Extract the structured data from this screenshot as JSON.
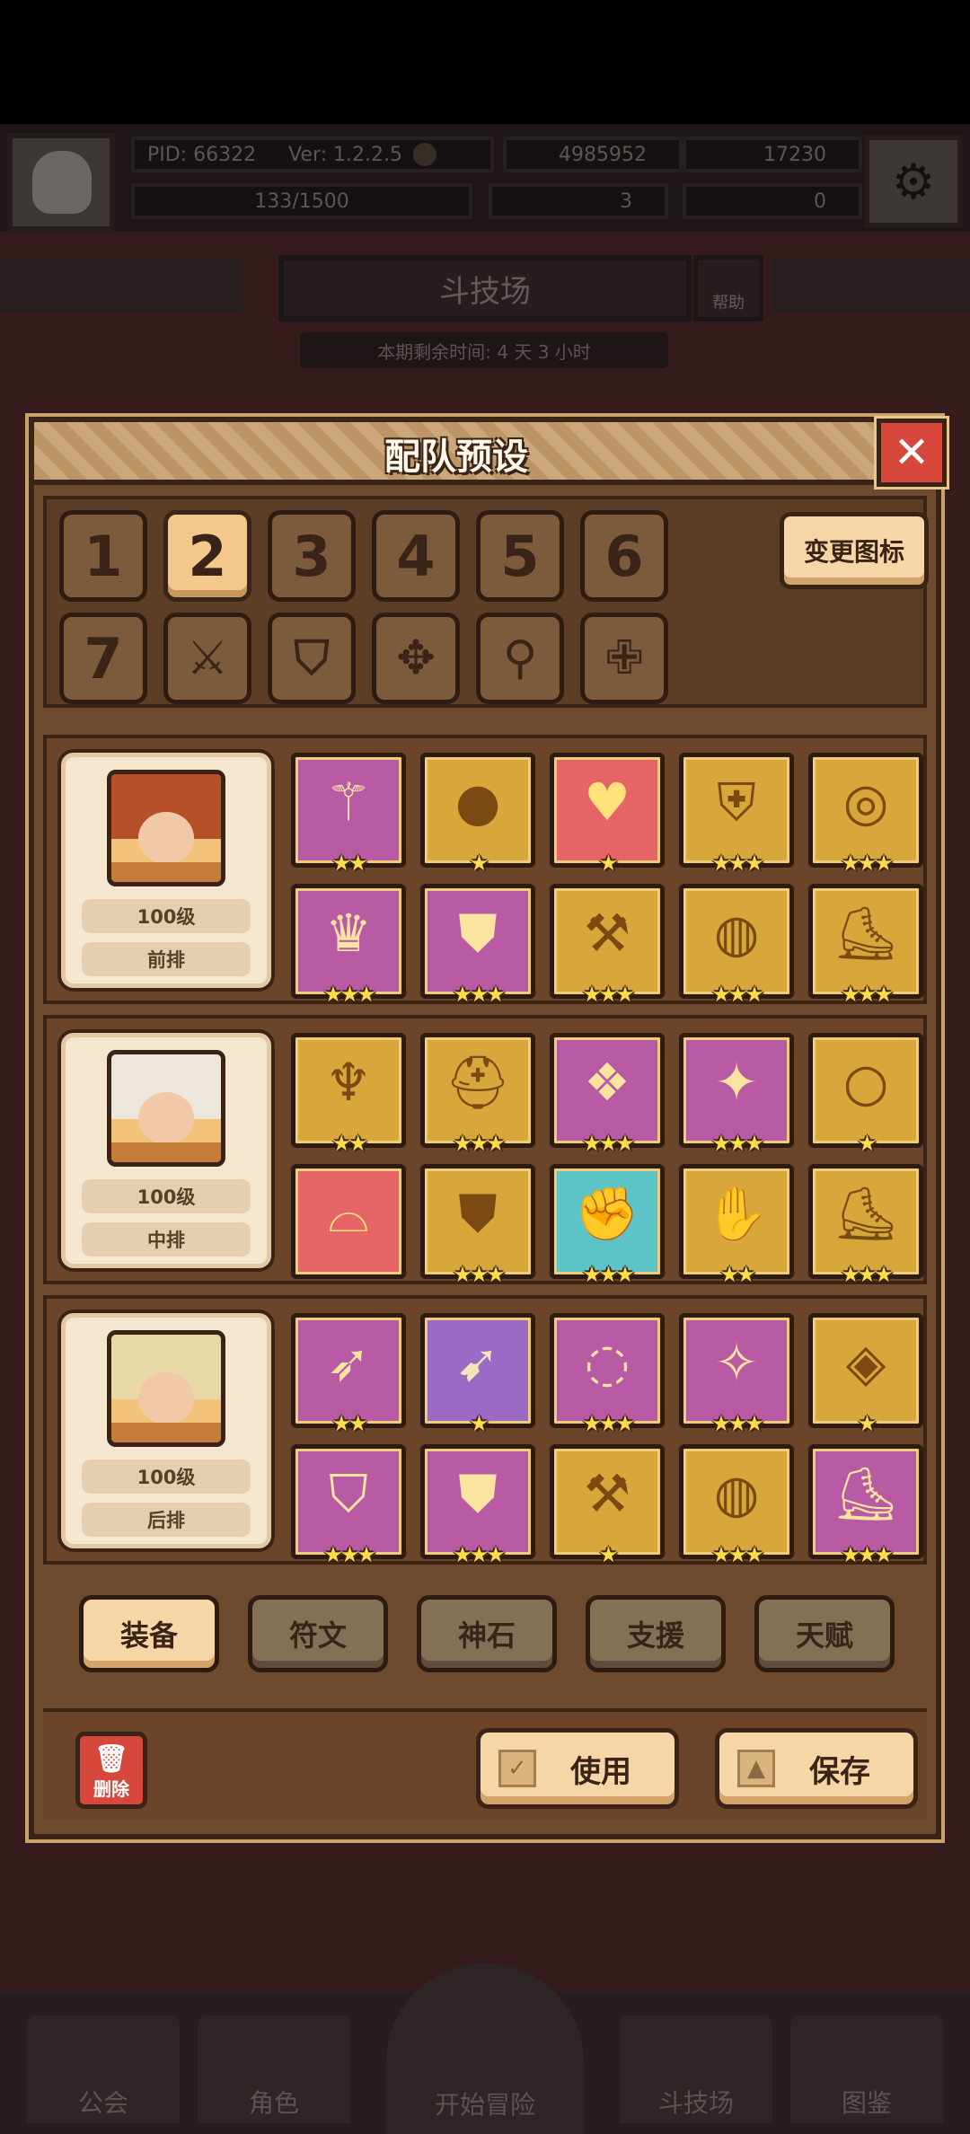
{
  "background": {
    "pid_label": "PID: 66322",
    "version_label": "Ver: 1.2.2.5",
    "gold_amount": "4985952",
    "gem_amount": "17230",
    "stamina": "133/1500",
    "clover_count": "3",
    "key_count": "0",
    "screen_title": "斗技场",
    "help_label": "帮助",
    "season_timer": "本期剩余时间: 4 天 3 小时",
    "nav": {
      "guild": "公会",
      "character": "角色",
      "start_adventure": "开始冒险",
      "arena": "斗技场",
      "codex": "图鉴"
    }
  },
  "dialog": {
    "title": "配队预设",
    "close_icon": "close-icon",
    "preset_slots": [
      {
        "label": "1",
        "selected": false
      },
      {
        "label": "2",
        "selected": true
      },
      {
        "label": "3",
        "selected": false
      },
      {
        "label": "4",
        "selected": false
      },
      {
        "label": "5",
        "selected": false
      },
      {
        "label": "6",
        "selected": false
      }
    ],
    "preset_icons": [
      "sword-icon",
      "shield-icon",
      "crosshair-icon",
      "staff-icon",
      "cross-icon"
    ],
    "preset_slot_7": "7",
    "change_icon_label": "变更图标",
    "heroes": [
      {
        "level": "100级",
        "position": "前排",
        "items": [
          {
            "icon": "scepter-icon",
            "rarity": "purple",
            "stars": 2
          },
          {
            "icon": "orb-icon",
            "rarity": "gold",
            "stars": 1
          },
          {
            "icon": "heart-necklace-icon",
            "rarity": "red",
            "stars": 1
          },
          {
            "icon": "gold-armor-icon",
            "rarity": "gold",
            "stars": 3
          },
          {
            "icon": "gold-ring-icon",
            "rarity": "gold",
            "stars": 3
          },
          {
            "icon": "crown-icon",
            "rarity": "purple",
            "stars": 3
          },
          {
            "icon": "robe-icon",
            "rarity": "purple",
            "stars": 3
          },
          {
            "icon": "hammer-icon",
            "rarity": "gold",
            "stars": 3
          },
          {
            "icon": "belt-icon",
            "rarity": "gold",
            "stars": 3
          },
          {
            "icon": "boots-icon",
            "rarity": "gold",
            "stars": 3
          }
        ]
      },
      {
        "level": "100级",
        "position": "中排",
        "items": [
          {
            "icon": "trident-icon",
            "rarity": "gold",
            "stars": 2
          },
          {
            "icon": "helm-icon",
            "rarity": "gold",
            "stars": 3
          },
          {
            "icon": "pendant-icon",
            "rarity": "purple",
            "stars": 3
          },
          {
            "icon": "jewel-armor-icon",
            "rarity": "purple",
            "stars": 3
          },
          {
            "icon": "blue-ring-icon",
            "rarity": "gold",
            "stars": 1
          },
          {
            "icon": "hat-icon",
            "rarity": "red",
            "stars": 0
          },
          {
            "icon": "red-cape-icon",
            "rarity": "gold",
            "stars": 3
          },
          {
            "icon": "gauntlet-icon",
            "rarity": "cyan",
            "stars": 3
          },
          {
            "icon": "green-gloves-icon",
            "rarity": "gold",
            "stars": 2
          },
          {
            "icon": "red-boots-icon",
            "rarity": "gold",
            "stars": 3
          }
        ]
      },
      {
        "level": "100级",
        "position": "后排",
        "items": [
          {
            "icon": "bow-icon",
            "rarity": "purple",
            "stars": 2
          },
          {
            "icon": "arrow-icon",
            "rarity": "violet",
            "stars": 1
          },
          {
            "icon": "pearl-necklace-icon",
            "rarity": "purple",
            "stars": 3
          },
          {
            "icon": "silver-charm-icon",
            "rarity": "purple",
            "stars": 3
          },
          {
            "icon": "gem-ring-icon",
            "rarity": "gold",
            "stars": 1
          },
          {
            "icon": "dark-helm-icon",
            "rarity": "purple",
            "stars": 3
          },
          {
            "icon": "dark-coat-icon",
            "rarity": "purple",
            "stars": 3
          },
          {
            "icon": "war-hammer-icon",
            "rarity": "gold",
            "stars": 1
          },
          {
            "icon": "leather-belt-icon",
            "rarity": "gold",
            "stars": 3
          },
          {
            "icon": "dark-boots-icon",
            "rarity": "purple",
            "stars": 3
          }
        ]
      }
    ],
    "tabs": [
      {
        "label": "装备",
        "selected": true
      },
      {
        "label": "符文",
        "selected": false
      },
      {
        "label": "神石",
        "selected": false
      },
      {
        "label": "支援",
        "selected": false
      },
      {
        "label": "天赋",
        "selected": false
      }
    ],
    "delete_label": "删除",
    "use_label": "使用",
    "save_label": "保存"
  }
}
